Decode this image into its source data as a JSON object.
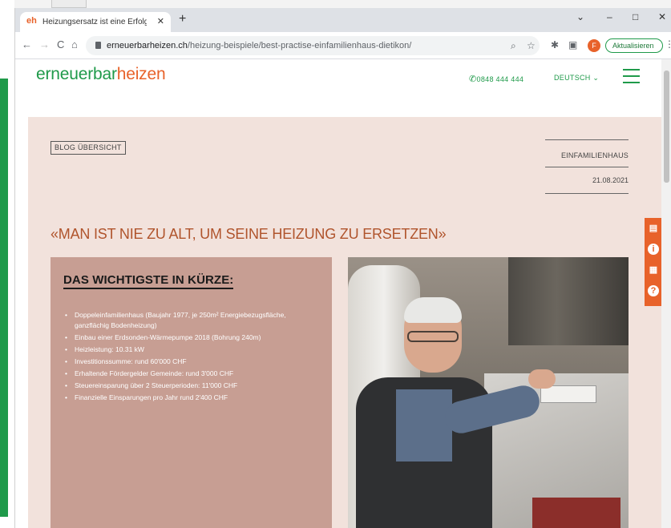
{
  "browser": {
    "tab_title": "Heizungsersatz ist eine Erfolgsgeschichte",
    "tab_favicon": "eh",
    "new_tab": "+",
    "url_domain": "erneuerbarheizen.ch",
    "url_path": "/heizung-beispiele/best-practise-einfamilienhaus-dietikon/",
    "profile_initial": "F",
    "update_label": "Aktualisieren",
    "window_controls": [
      "⌄",
      "–",
      "□",
      "✕"
    ]
  },
  "site": {
    "logo_part1": "erneuerbar",
    "logo_part2": "heizen",
    "phone": "0848 444 444",
    "language": "DEUTSCH ⌄"
  },
  "article": {
    "blog_button": "BLOG ÜBERSICHT",
    "category": "EINFAMILIENHAUS",
    "date": "21.08.2021",
    "headline": "«MAN IST NIE ZU ALT, UM SEINE HEIZUNG ZU ERSETZEN»",
    "summary_title": "DAS WICHTIGSTE IN KÜRZE:",
    "summary_items": [
      "Doppeleinfamilienhaus (Baujahr 1977, je 250m² Energiebezugsfläche, ganzflächig Bodenheizung)",
      "Einbau einer Erdsonden-Wärmepumpe 2018 (Bohrung 240m)",
      "Heizleistung: 10.31 kW",
      "Investitionssumme: rund 60'000 CHF",
      "Erhaltende Fördergelder Gemeinde: rund 3'000 CHF",
      "Steuereinsparung über 2 Steuerperioden: 11'000 CHF",
      "Finanzielle Einsparungen pro Jahr rund 2'400 CHF"
    ]
  },
  "colors": {
    "brand_green": "#1f9a4a",
    "brand_orange": "#e8622a",
    "panel_bg": "#f2e2dc",
    "summary_bg": "#c79e93",
    "headline": "#b0542c"
  },
  "icons": [
    "back-arrow-icon",
    "forward-arrow-icon",
    "reload-icon",
    "home-icon",
    "lock-icon",
    "search-icon",
    "star-icon",
    "extensions-icon",
    "sidebar-icon",
    "phone-icon",
    "hamburger-menu-icon",
    "document-icon",
    "info-icon",
    "calculator-icon",
    "help-icon"
  ]
}
